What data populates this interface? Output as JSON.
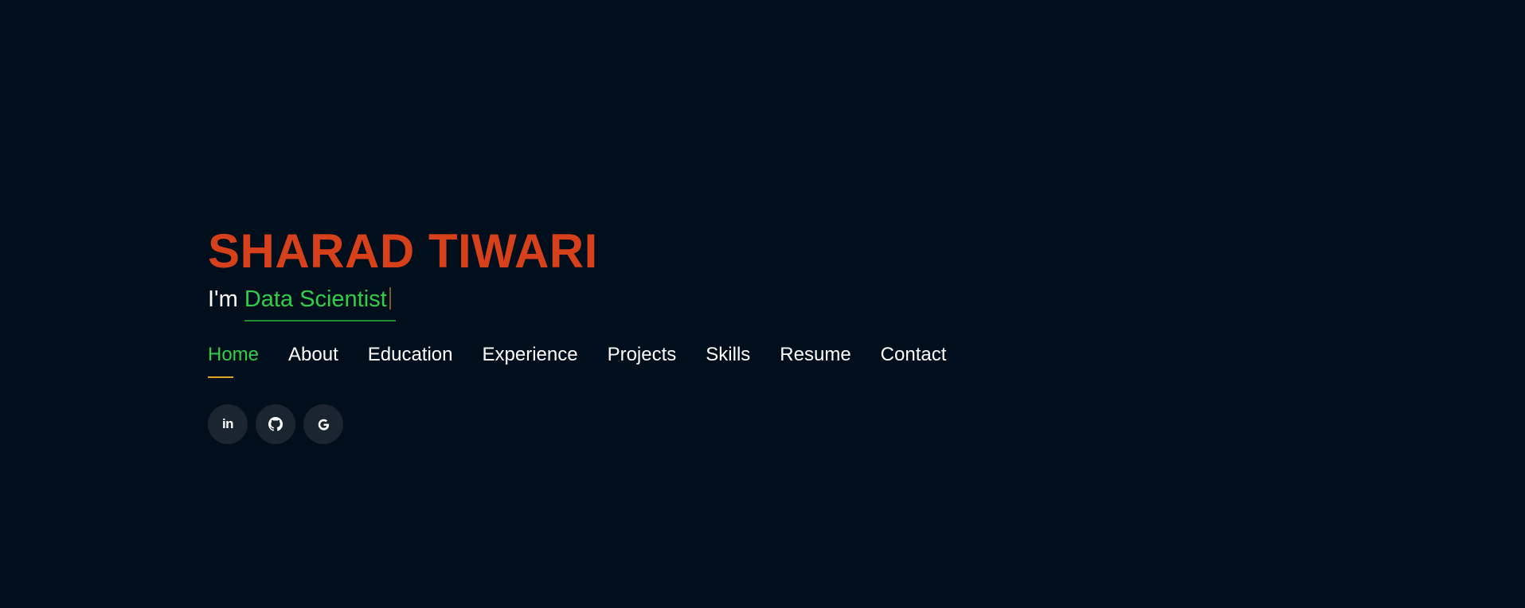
{
  "hero": {
    "name": "SHARAD TIWARI",
    "tagline_prefix": "I'm ",
    "tagline_role": "Data Scientist"
  },
  "nav": {
    "items": [
      {
        "label": "Home",
        "active": true
      },
      {
        "label": "About"
      },
      {
        "label": "Education"
      },
      {
        "label": "Experience"
      },
      {
        "label": "Projects"
      },
      {
        "label": "Skills"
      },
      {
        "label": "Resume"
      },
      {
        "label": "Contact"
      }
    ]
  },
  "social": {
    "linkedin_icon_text": "in",
    "icons": [
      "linkedin-icon",
      "github-icon",
      "google-icon"
    ]
  },
  "colors": {
    "background": "#010e1b",
    "name": "#d6401b",
    "accent_green": "#2fcf4c",
    "active_underline": "#e0a526",
    "social_button_bg": "#1b2530"
  }
}
